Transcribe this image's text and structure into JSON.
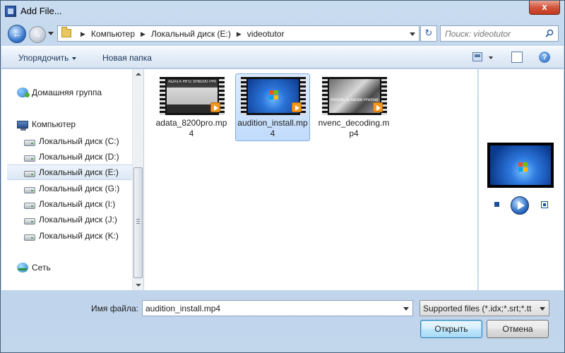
{
  "window": {
    "title": "Add File...",
    "close_label": "x"
  },
  "nav": {
    "back_label": "←",
    "forward_label": "→",
    "breadcrumbs": [
      "Компьютер",
      "Локальный диск (E:)",
      "videotutor"
    ],
    "refresh_label": "↻"
  },
  "search": {
    "placeholder": "Поиск: videotutor"
  },
  "toolbar": {
    "organize_label": "Упорядочить",
    "new_folder_label": "Новая папка",
    "help_label": "?"
  },
  "sidebar": {
    "items": [
      {
        "label": "Домашняя группа",
        "icon": "homegroup-icon"
      },
      {
        "label": "Компьютер",
        "icon": "computer-icon"
      },
      {
        "label": "Локальный диск (C:)",
        "icon": "drive-icon"
      },
      {
        "label": "Локальный диск (D:)",
        "icon": "drive-icon"
      },
      {
        "label": "Локальный диск (E:)",
        "icon": "drive-icon",
        "selected": true
      },
      {
        "label": "Локальный диск (G:)",
        "icon": "drive-icon"
      },
      {
        "label": "Локальный диск (I:)",
        "icon": "drive-icon"
      },
      {
        "label": "Локальный диск (J:)",
        "icon": "drive-icon"
      },
      {
        "label": "Локальный диск (K:)",
        "icon": "drive-icon"
      },
      {
        "label": "Сеть",
        "icon": "network-icon"
      }
    ]
  },
  "files": [
    {
      "name": "adata_8200pro.mp4",
      "thumb_caption": "ADATA HFG SH8200 PRO",
      "selected": false
    },
    {
      "name": "audition_install.mp4",
      "thumb_caption": "",
      "selected": true
    },
    {
      "name": "nvenc_decoding.mp4",
      "thumb_caption": "NVENC & Adobe Premiere",
      "selected": false
    }
  ],
  "bottom": {
    "filename_label": "Имя файла:",
    "filename_value": "audition_install.mp4",
    "filter_value": "Supported files (*.idx;*.srt;*.tt",
    "open_label": "Открыть",
    "cancel_label": "Отмена"
  },
  "colors": {
    "selection": "#c1dbfc",
    "accent": "#3c7fb1"
  }
}
